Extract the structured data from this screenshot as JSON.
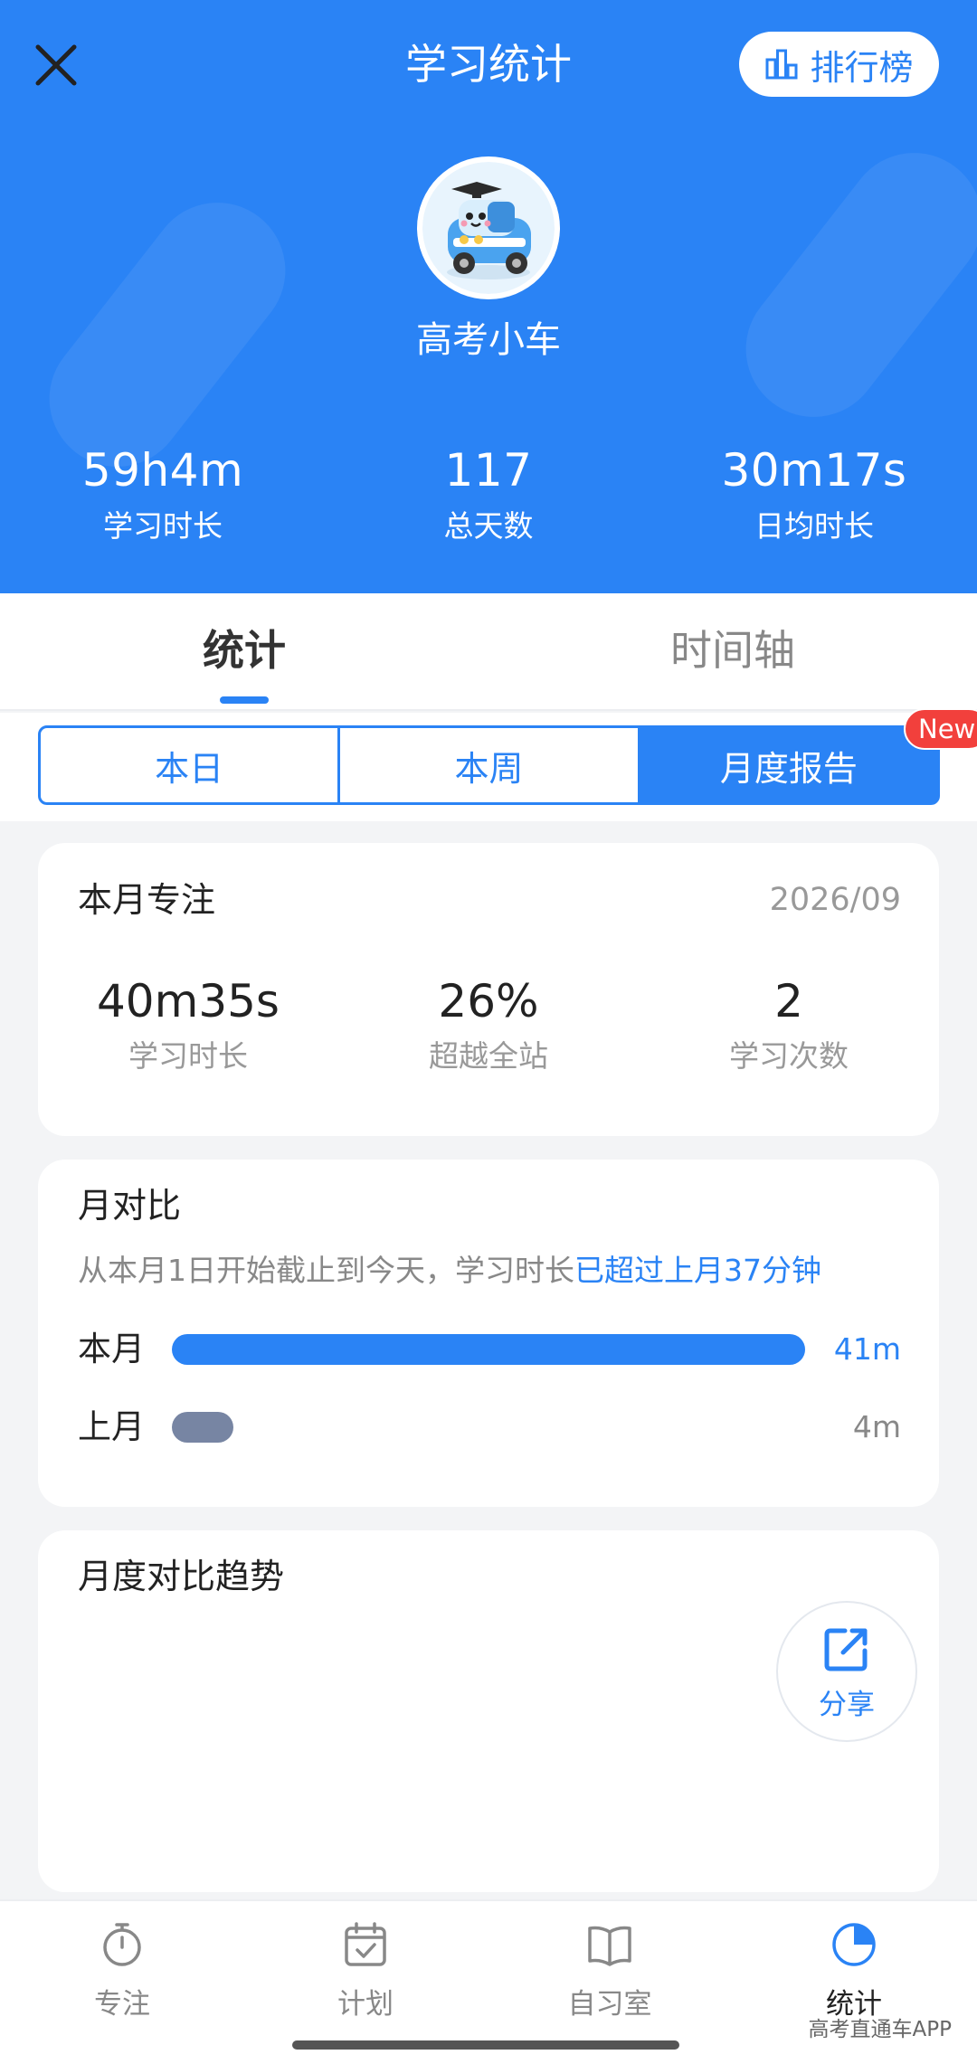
{
  "header": {
    "title": "学习统计",
    "rank_label": "排行榜",
    "username": "高考小车",
    "stats": [
      {
        "value": "59h4m",
        "label": "学习时长"
      },
      {
        "value": "117",
        "label": "总天数"
      },
      {
        "value": "30m17s",
        "label": "日均时长"
      }
    ]
  },
  "tabs": [
    "统计",
    "时间轴"
  ],
  "segments": [
    "本日",
    "本周",
    "月度报告"
  ],
  "new_badge": "New",
  "month_focus": {
    "title": "本月专注",
    "date": "2026/09",
    "stats": [
      {
        "value": "40m35s",
        "label": "学习时长"
      },
      {
        "value": "26%",
        "label": "超越全站"
      },
      {
        "value": "2",
        "label": "学习次数"
      }
    ]
  },
  "month_compare": {
    "title": "月对比",
    "subtitle_prefix": "从本月1日开始截止到今天，学习时长",
    "subtitle_highlight": "已超过上月37分钟",
    "rows": [
      {
        "label": "本月",
        "value": "41m",
        "minutes": 41
      },
      {
        "label": "上月",
        "value": "4m",
        "minutes": 4
      }
    ]
  },
  "trend": {
    "title": "月度对比趋势"
  },
  "share_label": "分享",
  "bottom_nav": [
    {
      "label": "专注",
      "icon": "stopwatch-icon"
    },
    {
      "label": "计划",
      "icon": "calendar-check-icon"
    },
    {
      "label": "自习室",
      "icon": "book-icon"
    },
    {
      "label": "统计",
      "icon": "pie-chart-icon"
    }
  ],
  "watermark": "高考直通车APP",
  "colors": {
    "primary": "#2a83f5",
    "last_month_bar": "#7785a3",
    "badge_red": "#f2403c"
  }
}
